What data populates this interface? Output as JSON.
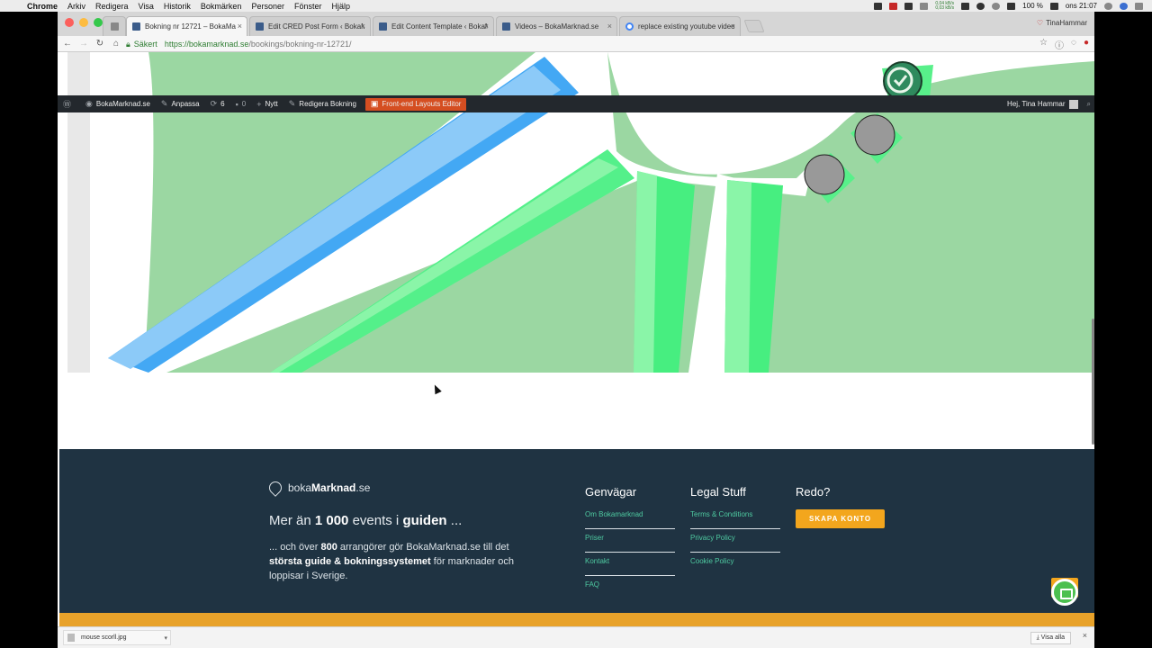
{
  "menubar": {
    "items": [
      "Chrome",
      "Arkiv",
      "Redigera",
      "Visa",
      "Historik",
      "Bokmärken",
      "Personer",
      "Fönster",
      "Hjälp"
    ],
    "net_up": "0,04 kB/s",
    "net_down": "0,03 kB/s",
    "battery": "100 %",
    "clock": "ons 21:07"
  },
  "browser": {
    "tabs": [
      {
        "label": "Bokning nr 12721 – BokaMa"
      },
      {
        "label": "Edit CRED Post Form ‹ BokaM"
      },
      {
        "label": "Edit Content Template ‹ BokaM"
      },
      {
        "label": "Videos – BokaMarknad.se"
      },
      {
        "label": "replace existing youtube video"
      }
    ],
    "profile_name": "TinaHammar",
    "secure_label": "Säkert",
    "url_base": "https://bokamarknad.se",
    "url_path": "/bookings/bokning-nr-12721/"
  },
  "wpbar": {
    "site": "BokaMarknad.se",
    "customize": "Anpassa",
    "updates": "6",
    "comments": "0",
    "new": "Nytt",
    "edit": "Redigera Bokning",
    "layouts": "Front-end Layouts Editor",
    "greeting": "Hej, Tina Hammar"
  },
  "footer": {
    "brand_light": "boka",
    "brand_bold": "Marknad",
    "brand_tld": ".se",
    "tagline_a": "Mer än ",
    "tagline_num": "1 000",
    "tagline_b": " events i ",
    "tagline_bold": "guiden",
    "tagline_end": " ...",
    "desc_a": "... och över ",
    "desc_num": "800",
    "desc_b": " arrangörer gör BokaMarknad.se till det ",
    "desc_bold": "största guide & bokningssystemet",
    "desc_c": " för marknader och loppisar i Sverige.",
    "col1_title": "Genvägar",
    "col1_links": [
      "Om Bokamarknad",
      "Priser",
      "Kontakt",
      "FAQ"
    ],
    "col2_title": "Legal Stuff",
    "col2_links": [
      "Terms & Conditions",
      "Privacy Policy",
      "Cookie Policy"
    ],
    "col3_title": "Redo?",
    "cta": "SKAPA KONTO"
  },
  "downloads": {
    "file": "mouse scorll.jpg",
    "show_all": "Visa alla"
  },
  "colors": {
    "hero_green": "#9bd7a2",
    "footer_bg": "#1f3342",
    "accent_orange": "#f3a61d",
    "link_teal": "#4ec9a0",
    "wp_orange": "#d54e21"
  }
}
